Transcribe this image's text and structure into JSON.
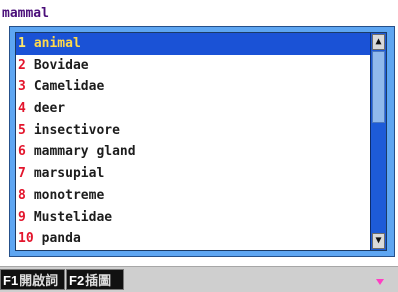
{
  "search": {
    "query": "mammal"
  },
  "dropdown": {
    "items": [
      {
        "num": "1",
        "label": "animal",
        "selected": true
      },
      {
        "num": "2",
        "label": "Bovidae"
      },
      {
        "num": "3",
        "label": "Camelidae"
      },
      {
        "num": "4",
        "label": "deer"
      },
      {
        "num": "5",
        "label": "insectivore"
      },
      {
        "num": "6",
        "label": "mammary gland"
      },
      {
        "num": "7",
        "label": "marsupial"
      },
      {
        "num": "8",
        "label": "monotreme"
      },
      {
        "num": "9",
        "label": "Mustelidae"
      },
      {
        "num": "10",
        "label": "panda"
      }
    ],
    "scroll_position": 0.0
  },
  "bottom_bar": {
    "f1_key": "F1",
    "f1_label": "開啟詞",
    "f2_key": "F2",
    "f2_label": "插圖"
  },
  "colors": {
    "selection": "#1a52d6",
    "number": "#e3152c",
    "scrollbar": "#1d5bd8",
    "popup_border": "#5ea6f2",
    "arrow": "#ff3ec3"
  },
  "icons": {
    "scroll_up": "triangle-up",
    "scroll_down": "triangle-down",
    "more_indicator": "triangle-down"
  }
}
